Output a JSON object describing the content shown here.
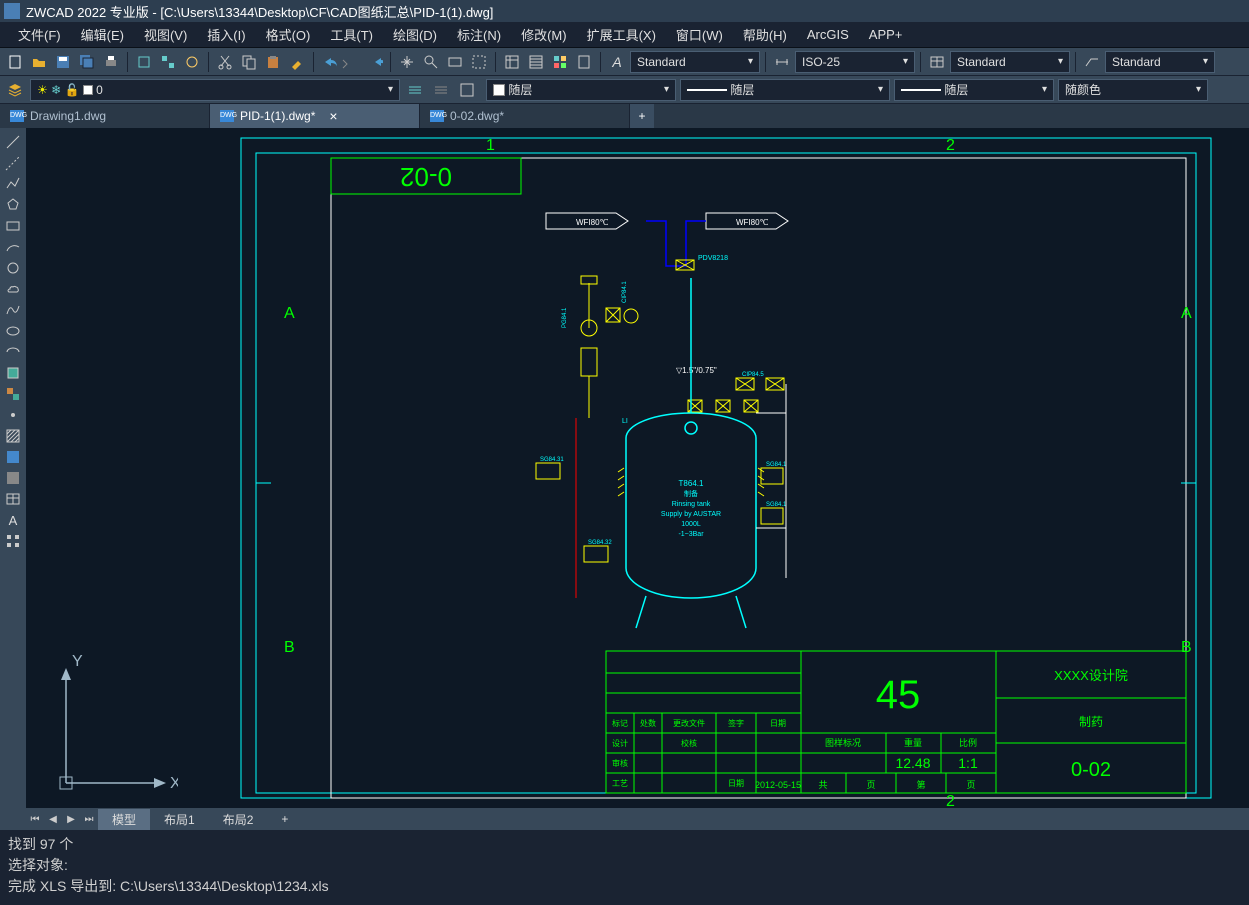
{
  "titlebar": {
    "app": "ZWCAD 2022 专业版",
    "path": "[C:\\Users\\13344\\Desktop\\CF\\CAD图纸汇总\\PID-1(1).dwg]"
  },
  "menu": [
    "文件(F)",
    "编辑(E)",
    "视图(V)",
    "插入(I)",
    "格式(O)",
    "工具(T)",
    "绘图(D)",
    "标注(N)",
    "修改(M)",
    "扩展工具(X)",
    "窗口(W)",
    "帮助(H)",
    "ArcGIS",
    "APP+"
  ],
  "toolbar1": {
    "textstyle": "Standard",
    "dimstyle": "ISO-25",
    "tablestyle": "Standard",
    "mleaderstyle": "Standard"
  },
  "layerbar": {
    "layer": "0",
    "p1": "随层",
    "p2": "随层",
    "p3": "随层",
    "p4": "随颜色"
  },
  "tabs": [
    {
      "label": "Drawing1.dwg",
      "active": false
    },
    {
      "label": "PID-1(1).dwg*",
      "active": true
    },
    {
      "label": "0-02.dwg*",
      "active": false
    }
  ],
  "bottomtabs": {
    "model": "模型",
    "layout1": "布局1",
    "layout2": "布局2"
  },
  "commandline": {
    "l1": "找到 97 个",
    "l2": "选择对象:",
    "l3": "完成 XLS 导出到: C:\\Users\\13344\\Desktop\\1234.xls"
  },
  "drawing": {
    "sheet_id": "0-02",
    "grid_col1": "1",
    "grid_col2": "2",
    "grid_rowA": "A",
    "grid_rowB": "B",
    "top_arrow1": "WFI80℃",
    "top_arrow2": "WFI80℃",
    "valve_tag": "PDV8218",
    "pipe_size": "▽1.5\"/0.75\"",
    "tank": {
      "tag": "T864.1",
      "sub": "制备",
      "name": "Rinsing tank",
      "supply": "Supply by AUSTAR",
      "vol": "1000L",
      "press": "-1~3Bar"
    },
    "titleblock": {
      "big": "45",
      "designer": "XXXX设计院",
      "sub": "制药",
      "scale_hdr": "图样标况",
      "weight_hdr": "重量",
      "ratio_hdr": "比例",
      "weight": "12.48",
      "scale": "1:1",
      "sheetno": "0-02",
      "date": "2012-05-15",
      "col2_1": "标记",
      "col2_2": "处数",
      "col2_3": "更改文件",
      "col2_4": "签字",
      "col2_5": "日期",
      "row3_1": "设计",
      "row3_2": "校核",
      "row4_1": "审核",
      "row4_2": "日期",
      "row5_1": "工艺",
      "bot_1": "共",
      "bot_2": "页",
      "bot_3": "第",
      "bot_4": "页"
    },
    "itags": {
      "t1": "PG84.1",
      "t2": "SG84.31",
      "t3": "SG84.32",
      "t4": "SG84.1",
      "t5": "SG84.1",
      "t6": "CIP84.1",
      "t7": "LI",
      "t8": "CIP84.5"
    }
  }
}
